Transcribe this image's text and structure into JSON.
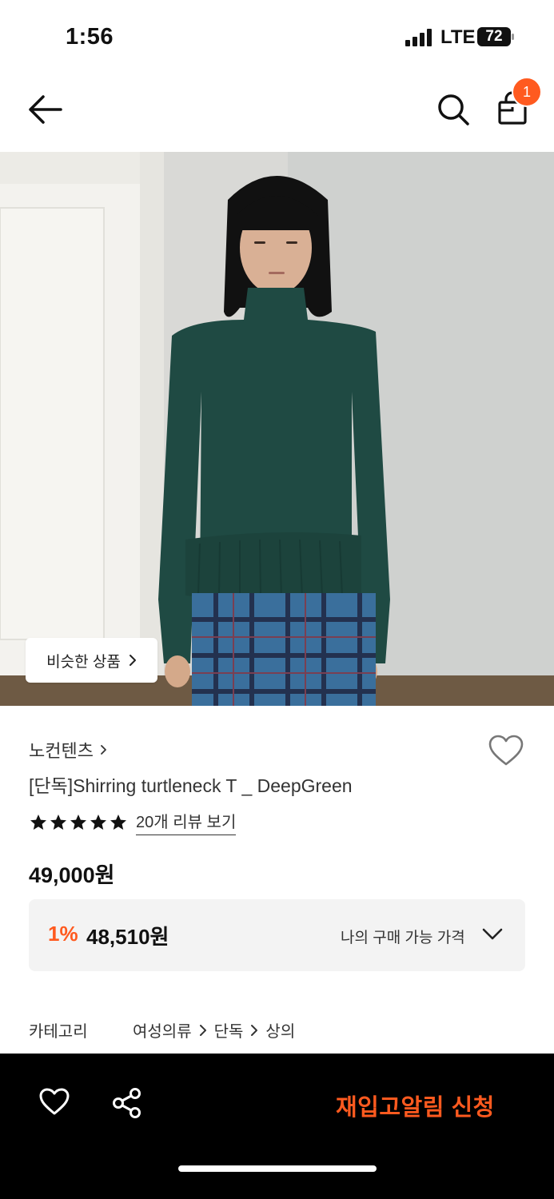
{
  "status_bar": {
    "time": "1:56",
    "network": "LTE",
    "battery": "72"
  },
  "header": {
    "cart_count": "1",
    "icons": [
      "back-arrow-icon",
      "search-icon",
      "shopping-bag-icon"
    ]
  },
  "hero": {
    "similar_button_label": "비슷한 상품"
  },
  "product": {
    "brand": "노컨텐츠",
    "name": "[단독]Shirring turtleneck T _ DeepGreen",
    "rating_stars": 5,
    "review_link": "20개 리뷰 보기",
    "price": "49,000원"
  },
  "my_price": {
    "discount": "1%",
    "price": "48,510원",
    "label": "나의 구매 가능 가격"
  },
  "category": {
    "label": "카테고리",
    "path": [
      "여성의류",
      "단독",
      "상의"
    ]
  },
  "bottom_bar": {
    "restock_button": "재입고알림 신청"
  },
  "colors": {
    "accent": "#ff5a1f",
    "bottom_bar_bg": "#000000",
    "price_box_bg": "#f3f3f3"
  }
}
